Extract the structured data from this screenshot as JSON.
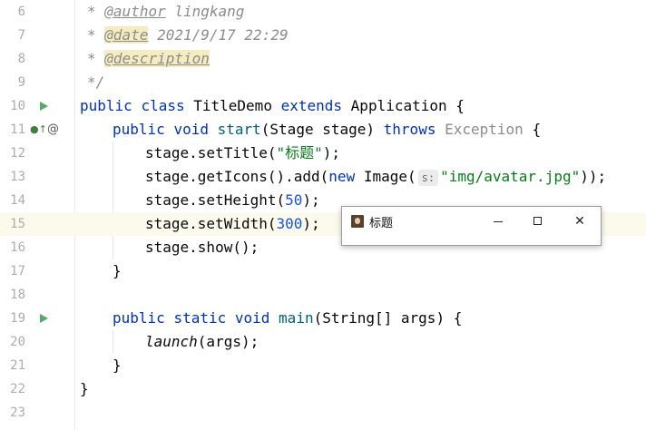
{
  "editor": {
    "lines": [
      {
        "n": "6"
      },
      {
        "n": "7"
      },
      {
        "n": "8"
      },
      {
        "n": "9"
      },
      {
        "n": "10"
      },
      {
        "n": "11"
      },
      {
        "n": "12"
      },
      {
        "n": "13"
      },
      {
        "n": "14"
      },
      {
        "n": "15"
      },
      {
        "n": "16"
      },
      {
        "n": "17"
      },
      {
        "n": "18"
      },
      {
        "n": "19"
      },
      {
        "n": "20"
      },
      {
        "n": "21"
      },
      {
        "n": "22"
      },
      {
        "n": "23"
      }
    ],
    "tokens": {
      "star": "*",
      "author_tag": "@author",
      "author_val": " lingkang",
      "date_tag": "@date",
      "date_val": " 2021/9/17 22:29",
      "desc_tag": "@description",
      "comment_end": "*/",
      "kw_public": "public",
      "kw_class": "class",
      "class_name": "TitleDemo",
      "kw_extends": "extends",
      "parent": "Application",
      "brace_open": "{",
      "brace_close": "}",
      "kw_void": "void",
      "kw_static": "static",
      "m_start": "start",
      "start_params": "(Stage stage)",
      "kw_throws": "throws",
      "exception": "Exception",
      "set_title": "stage.setTitle(",
      "title_str": "\"标题\"",
      "paren_semi": ");",
      "get_icons": "stage.getIcons().add(",
      "kw_new": "new",
      "image_open": " Image(",
      "hint_s": "s:",
      "img_path": "\"img/avatar.jpg\"",
      "double_close": "));",
      "set_height": "stage.setHeight(",
      "height_val": "50",
      "set_width": "stage.setWidth(",
      "width_val": "300",
      "show": "stage.show();",
      "m_main": "main",
      "main_params": "(String[] args)",
      "launch": "launch",
      "launch_args": "(args);"
    }
  },
  "window": {
    "title": "标题",
    "minimize": "–",
    "maximize": "□",
    "close": "✕"
  },
  "colors": {
    "keyword": "#0033b3",
    "string": "#067d17",
    "number": "#1750eb",
    "comment": "#8c8c8c",
    "current_line": "#fcfaed"
  }
}
